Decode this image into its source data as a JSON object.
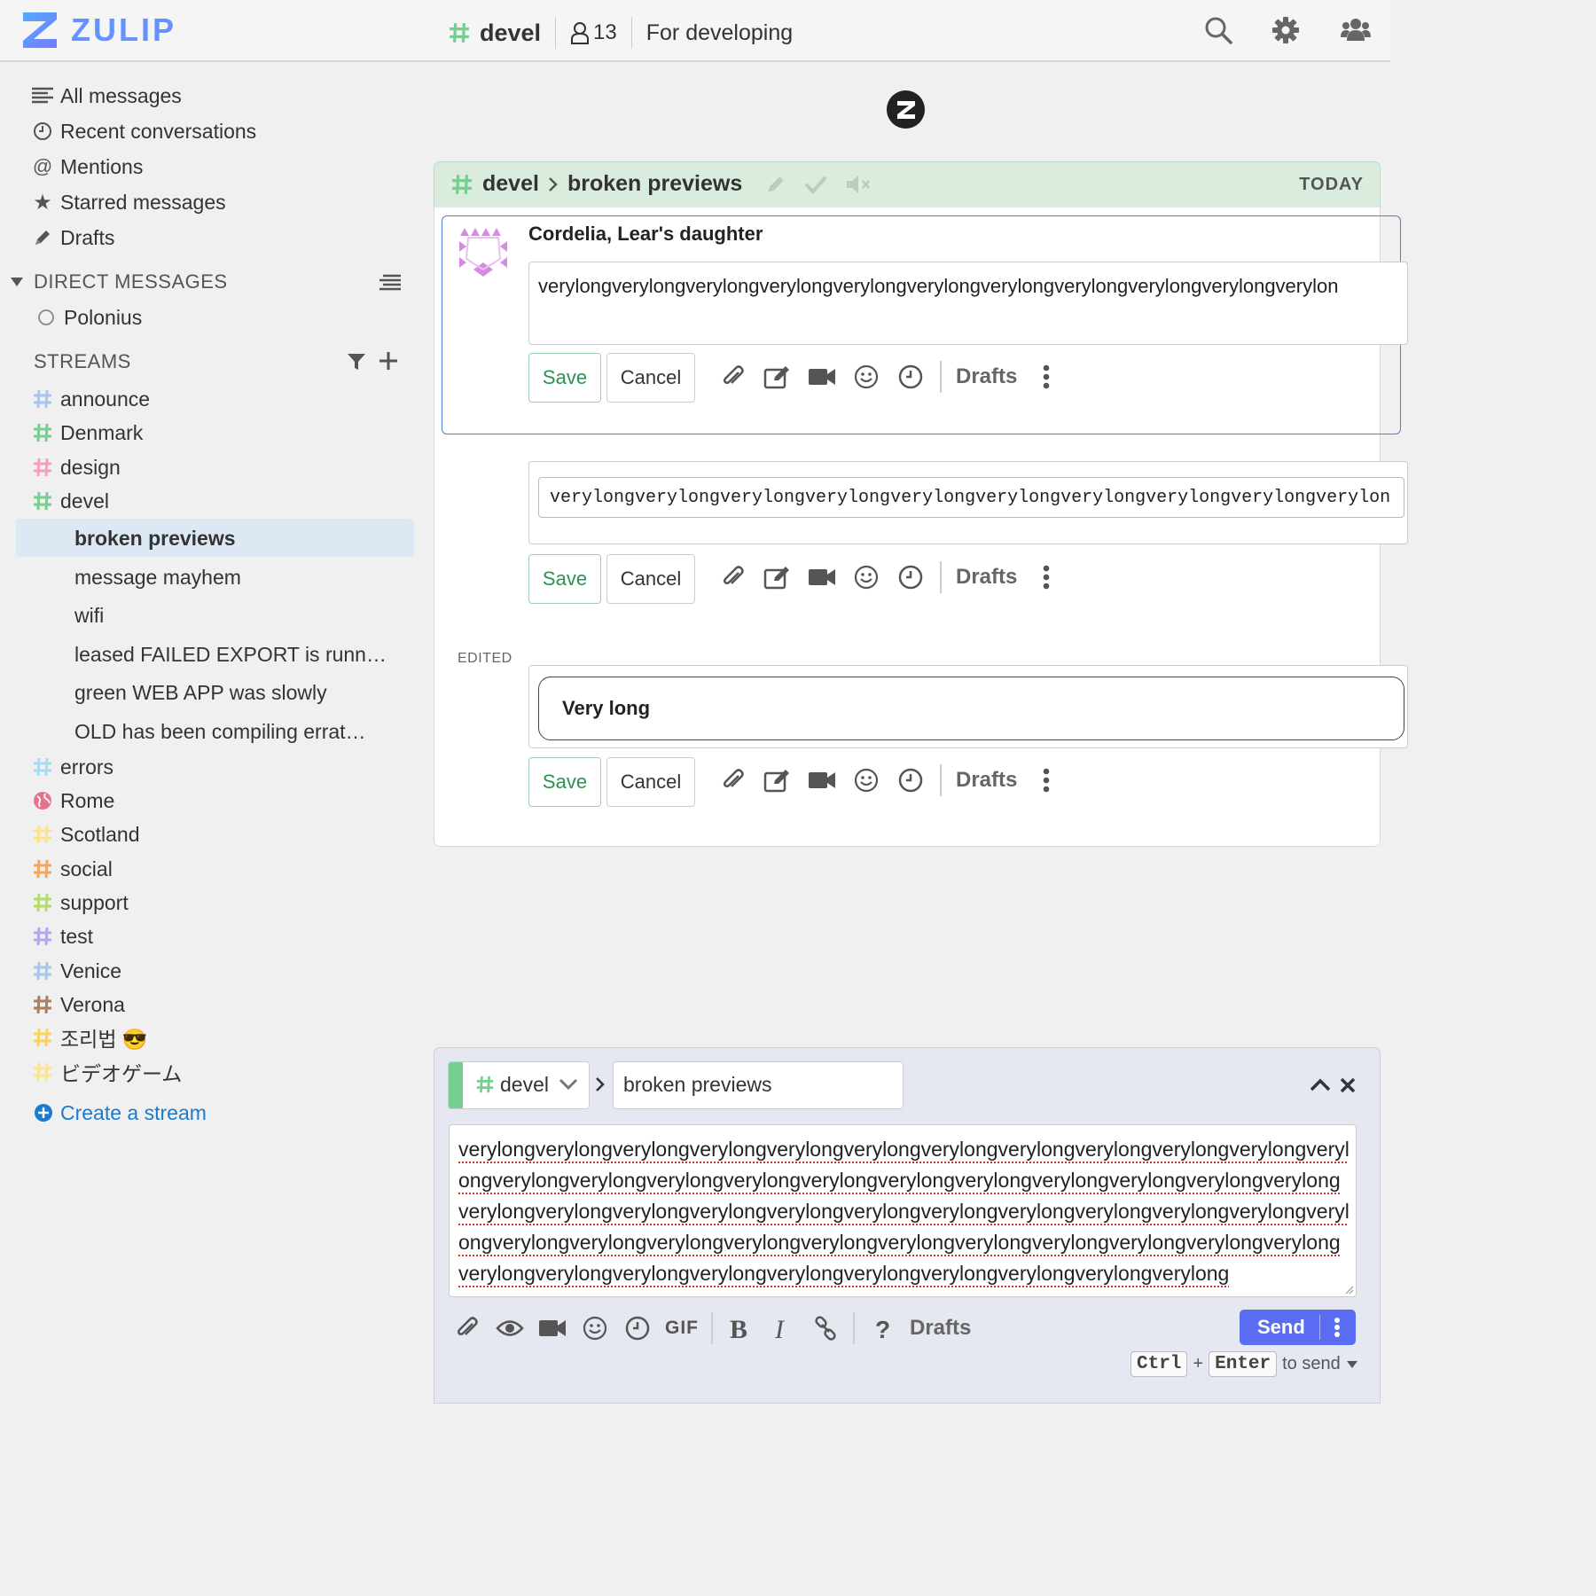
{
  "brand": {
    "name": "ZULIP"
  },
  "header": {
    "stream_name": "devel",
    "subscriber_count": "13",
    "description": "For developing"
  },
  "sidebar": {
    "views": [
      {
        "label": "All messages",
        "icon": "all-messages-icon"
      },
      {
        "label": "Recent conversations",
        "icon": "clock-icon"
      },
      {
        "label": "Mentions",
        "icon": "at-icon"
      },
      {
        "label": "Starred messages",
        "icon": "star-icon"
      },
      {
        "label": "Drafts",
        "icon": "pencil-icon"
      }
    ],
    "direct_messages": {
      "title": "DIRECT MESSAGES",
      "users": [
        "Polonius"
      ]
    },
    "streams_title": "STREAMS",
    "streams": [
      {
        "name": "announce",
        "color": "#a9c7ee"
      },
      {
        "name": "Denmark",
        "color": "#76ce90"
      },
      {
        "name": "design",
        "color": "#f4a1b5"
      },
      {
        "name": "devel",
        "color": "#76ce90"
      },
      {
        "name": "errors",
        "color": "#a6dcf2"
      },
      {
        "name": "Rome",
        "color": "#e4748e"
      },
      {
        "name": "Scotland",
        "color": "#fbe48d"
      },
      {
        "name": "social",
        "color": "#f3a75b"
      },
      {
        "name": "support",
        "color": "#b3dd6a"
      },
      {
        "name": "test",
        "color": "#b6a6ef"
      },
      {
        "name": "Venice",
        "color": "#a9c7ee"
      },
      {
        "name": "Verona",
        "color": "#a87e64"
      },
      {
        "name": "조리법 😎",
        "color": "#fbd35c"
      },
      {
        "name": "ビデオゲーム",
        "color": "#fbe48d"
      }
    ],
    "topics": [
      "broken previews",
      "message mayhem",
      "wifi",
      "leased FAILED EXPORT is runn…",
      "green WEB APP was slowly",
      "OLD has been compiling errat…"
    ],
    "create_stream": "Create a stream"
  },
  "feed": {
    "recipient": {
      "stream": "devel",
      "topic": "broken previews",
      "date": "TODAY"
    },
    "sender": "Cordelia, Lear's daughter",
    "edits": [
      {
        "text": "verylongverylongverylongverylongverylongverylongverylongverylongverylongverylongverylon"
      },
      {
        "text": "verylongverylongverylongverylongverylongverylongverylongverylongverylongverylon"
      },
      {
        "label": "EDITED",
        "text": "Very long"
      }
    ],
    "save_label": "Save",
    "cancel_label": "Cancel",
    "drafts_label": "Drafts"
  },
  "compose": {
    "stream": "devel",
    "topic": "broken previews",
    "content": "verylongverylongverylongverylongverylongverylongverylongverylongverylongverylongverylongverylongverylongverylongverylongverylongverylongverylongverylongverylongverylongverylongverylongverylongverylongverylongverylongverylongverylongverylongverylongverylongverylongverylongverylongverylongverylongverylongverylongverylongverylongverylongverylongverylongverylongverylongverylongverylongverylongverylongverylongverylongverylongverylongverylongverylong",
    "gif_label": "GIF",
    "drafts_label": "Drafts",
    "send_label": "Send",
    "hint": {
      "key1": "Ctrl",
      "plus": "+",
      "key2": "Enter",
      "suffix": "to send"
    }
  }
}
